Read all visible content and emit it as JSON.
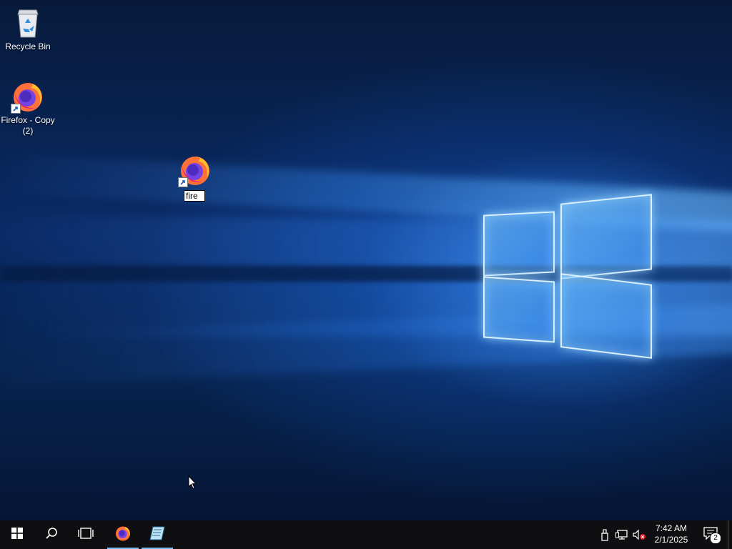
{
  "desktop": {
    "icons": [
      {
        "label": "Recycle Bin"
      },
      {
        "label": "Firefox - Copy (2)"
      }
    ],
    "rename": {
      "value": "fire"
    }
  },
  "taskbar": {
    "start_icon": "windows-logo-icon",
    "search_icon": "search-icon",
    "taskview_icon": "task-view-icon",
    "pinned": [
      "firefox-icon",
      "notepad-icon"
    ],
    "tray": {
      "icons": [
        "usb-device-icon",
        "network-icon",
        "volume-muted-icon"
      ],
      "time": "7:42 AM",
      "date": "2/1/2025",
      "notification_count": "2"
    }
  },
  "colors": {
    "taskbar_bg": "#0f0f12",
    "active_indicator": "#77b9ee",
    "wallpaper_dark": "#071a3a",
    "wallpaper_glow": "#3c96ff"
  }
}
